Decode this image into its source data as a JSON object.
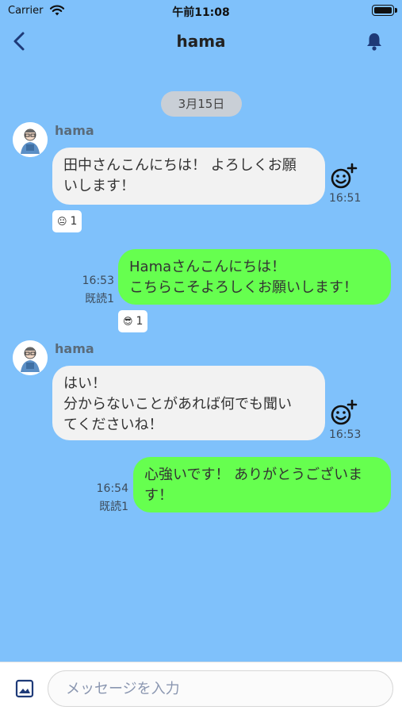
{
  "status_bar": {
    "carrier": "Carrier",
    "time": "午前11:08"
  },
  "nav": {
    "title": "hama"
  },
  "date_label": "3月15日",
  "messages": [
    {
      "direction": "in",
      "sender": "hama",
      "text": "田中さんこんにちは！ よろしくお願\nいします！",
      "time": "16:51",
      "reaction": {
        "emoji": "😐",
        "count": "1"
      }
    },
    {
      "direction": "out",
      "text": "Hamaさんこんにちは！\nこちらこそよろしくお願いします！",
      "time": "16:53",
      "read": "既読1",
      "reaction": {
        "emoji": "😎",
        "count": "1"
      }
    },
    {
      "direction": "in",
      "sender": "hama",
      "text": "はい！\n分からないことがあれば何でも聞い\nてくださいね！",
      "time": "16:53"
    },
    {
      "direction": "out",
      "text": "心強いです！ ありがとうございま\nす！",
      "time": "16:54",
      "read": "既読1"
    }
  ],
  "input": {
    "placeholder": "メッセージを入力"
  },
  "colors": {
    "background": "#7fc1fb",
    "outgoing_bubble": "#66ff4f",
    "incoming_bubble": "#f2f2f2",
    "accent": "#1e3a78"
  }
}
